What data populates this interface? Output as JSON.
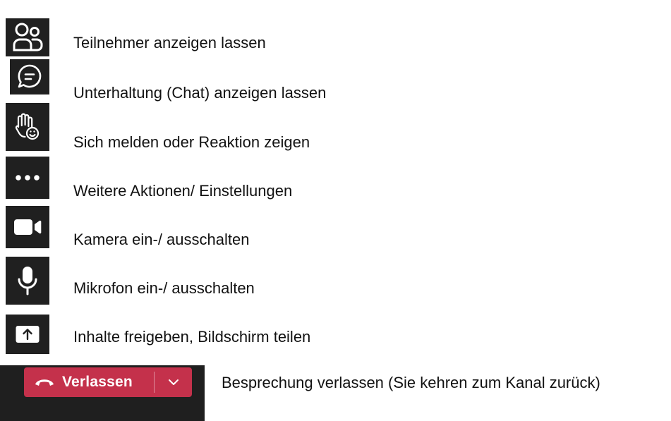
{
  "legend": [
    {
      "icon": "participants-icon",
      "text": "Teilnehmer anzeigen lassen"
    },
    {
      "icon": "chat-icon",
      "text": "Unterhaltung (Chat) anzeigen lassen"
    },
    {
      "icon": "raise-hand-reaction-icon",
      "text": "Sich melden oder Reaktion zeigen"
    },
    {
      "icon": "more-actions-icon",
      "text": "Weitere Aktionen/ Einstellungen"
    },
    {
      "icon": "camera-icon",
      "text": "Kamera ein-/ ausschalten"
    },
    {
      "icon": "microphone-icon",
      "text": "Mikrofon ein-/ ausschalten"
    },
    {
      "icon": "share-screen-icon",
      "text": "Inhalte freigeben, Bildschirm teilen"
    }
  ],
  "leave": {
    "button_label": "Verlassen",
    "icon": "hang-up-icon",
    "dropdown_icon": "chevron-down-icon",
    "description": "Besprechung verlassen (Sie kehren zum Kanal zurück)"
  },
  "colors": {
    "icon_background": "#202020",
    "leave_button": "#c4314b",
    "icon_foreground": "#ffffff"
  }
}
